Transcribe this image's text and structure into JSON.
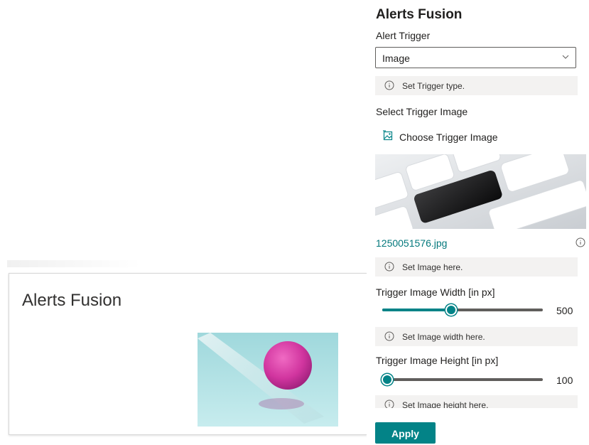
{
  "webpart": {
    "title": "Alerts Fusion"
  },
  "pane": {
    "title": "Alerts Fusion",
    "alert_trigger": {
      "label": "Alert Trigger",
      "selected": "Image",
      "info": "Set Trigger type."
    },
    "trigger_image": {
      "label": "Select Trigger Image",
      "choose_label": "Choose Trigger Image",
      "filename": "1250051576.jpg",
      "info": "Set Image here."
    },
    "width": {
      "label": "Trigger Image Width [in px]",
      "value": "500",
      "fraction": 0.43,
      "info": "Set Image width here."
    },
    "height": {
      "label": "Trigger Image Height [in px]",
      "value": "100",
      "fraction": 0.03,
      "info": "Set Image height here."
    },
    "apply_label": "Apply"
  },
  "colors": {
    "accent": "#038387",
    "link": "#03787c",
    "info_bg": "#f3f2f1"
  },
  "icons": {
    "dropdown": "chevron-down-icon",
    "info": "info-icon",
    "choose": "image-file-icon"
  }
}
